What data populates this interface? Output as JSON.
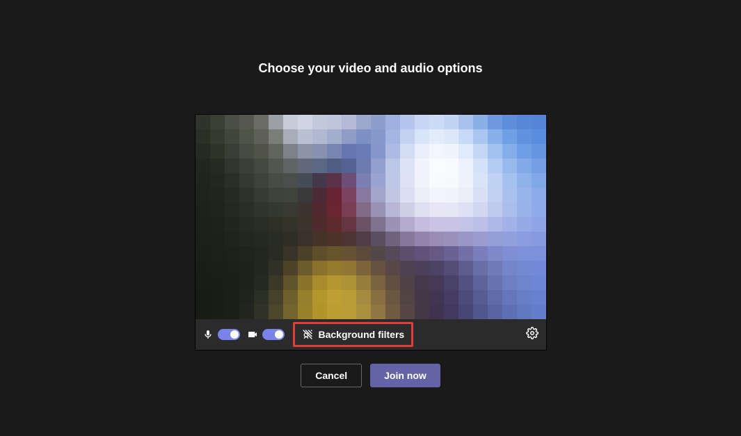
{
  "title": "Choose your video and audio options",
  "controls": {
    "mic_on": true,
    "camera_on": true,
    "filters_label": "Background filters"
  },
  "actions": {
    "cancel_label": "Cancel",
    "join_label": "Join now"
  },
  "colors": {
    "accent": "#6264a7",
    "toggle": "#7b83eb",
    "highlight_border": "#e03e36"
  }
}
